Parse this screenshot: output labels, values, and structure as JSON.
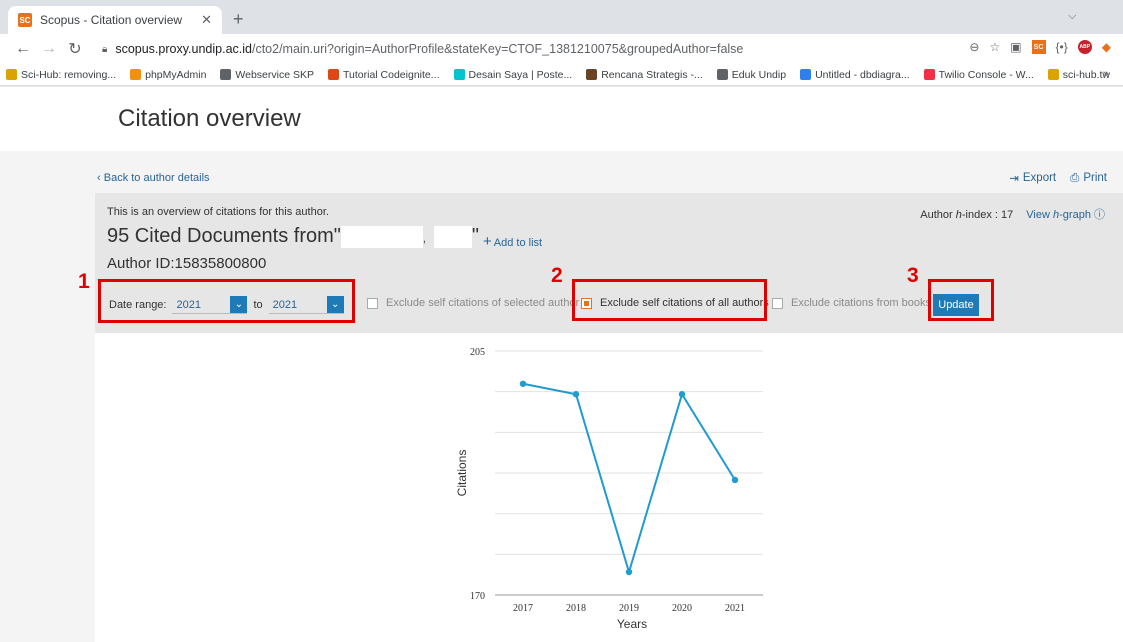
{
  "browser": {
    "tab_title": "Scopus - Citation overview",
    "tab_favicon": "SC",
    "url_host": "scopus.proxy.undip.ac.id",
    "url_path": "/cto2/main.uri?origin=AuthorProfile&stateKey=CTOF_1381210075&groupedAuthor=false",
    "bookmarks": [
      {
        "label": "Sci-Hub: removing...",
        "color": "#d9a300"
      },
      {
        "label": "phpMyAdmin",
        "color": "#f29111"
      },
      {
        "label": "Webservice SKP",
        "color": "#5f6368"
      },
      {
        "label": "Tutorial Codeignite...",
        "color": "#dd4814"
      },
      {
        "label": "Desain Saya | Poste...",
        "color": "#00c4cc"
      },
      {
        "label": "Rencana Strategis -...",
        "color": "#6b4226"
      },
      {
        "label": "Eduk Undip",
        "color": "#5f6368"
      },
      {
        "label": "Untitled - dbdiagra...",
        "color": "#2f80ed"
      },
      {
        "label": "Twilio Console - W...",
        "color": "#f22f46"
      },
      {
        "label": "sci-hub.tw",
        "color": "#d9a300"
      }
    ],
    "bookmarks_more": "»"
  },
  "page": {
    "title": "Citation overview",
    "back_link": "Back to author details",
    "export": "Export",
    "print": "Print",
    "overview_text": "This is an overview of citations for this author.",
    "hindex_label": "Author",
    "hindex_italic": "h",
    "hindex_rest": "-index : 17",
    "view_hgraph_pre": "View",
    "view_hgraph_italic": "h",
    "view_hgraph_post": "-graph",
    "cited_docs": "95 Cited Documents from\"",
    "cited_comma": ",",
    "cited_quote": "\"",
    "add_to_list": "Add to list",
    "author_id": "Author ID:15835800800",
    "date_range_label": "Date range:",
    "date_from": "2021",
    "date_to_label": "to",
    "date_to": "2021",
    "exclude_selected": "Exclude self citations of selected author",
    "exclude_all": "Exclude self citations of all authors",
    "exclude_books": "Exclude citations from books",
    "update": "Update"
  },
  "annotations": [
    "1",
    "2",
    "3"
  ],
  "chart_data": {
    "type": "line",
    "x": [
      2017,
      2018,
      2019,
      2020,
      2021
    ],
    "values": [
      200.3,
      198.8,
      173.3,
      198.8,
      186.5
    ],
    "ylim": [
      170,
      205
    ],
    "yticks": [
      170,
      205
    ],
    "xlabel": "Years",
    "ylabel": "Citations",
    "grid": true,
    "color": "#1f9bcf"
  }
}
